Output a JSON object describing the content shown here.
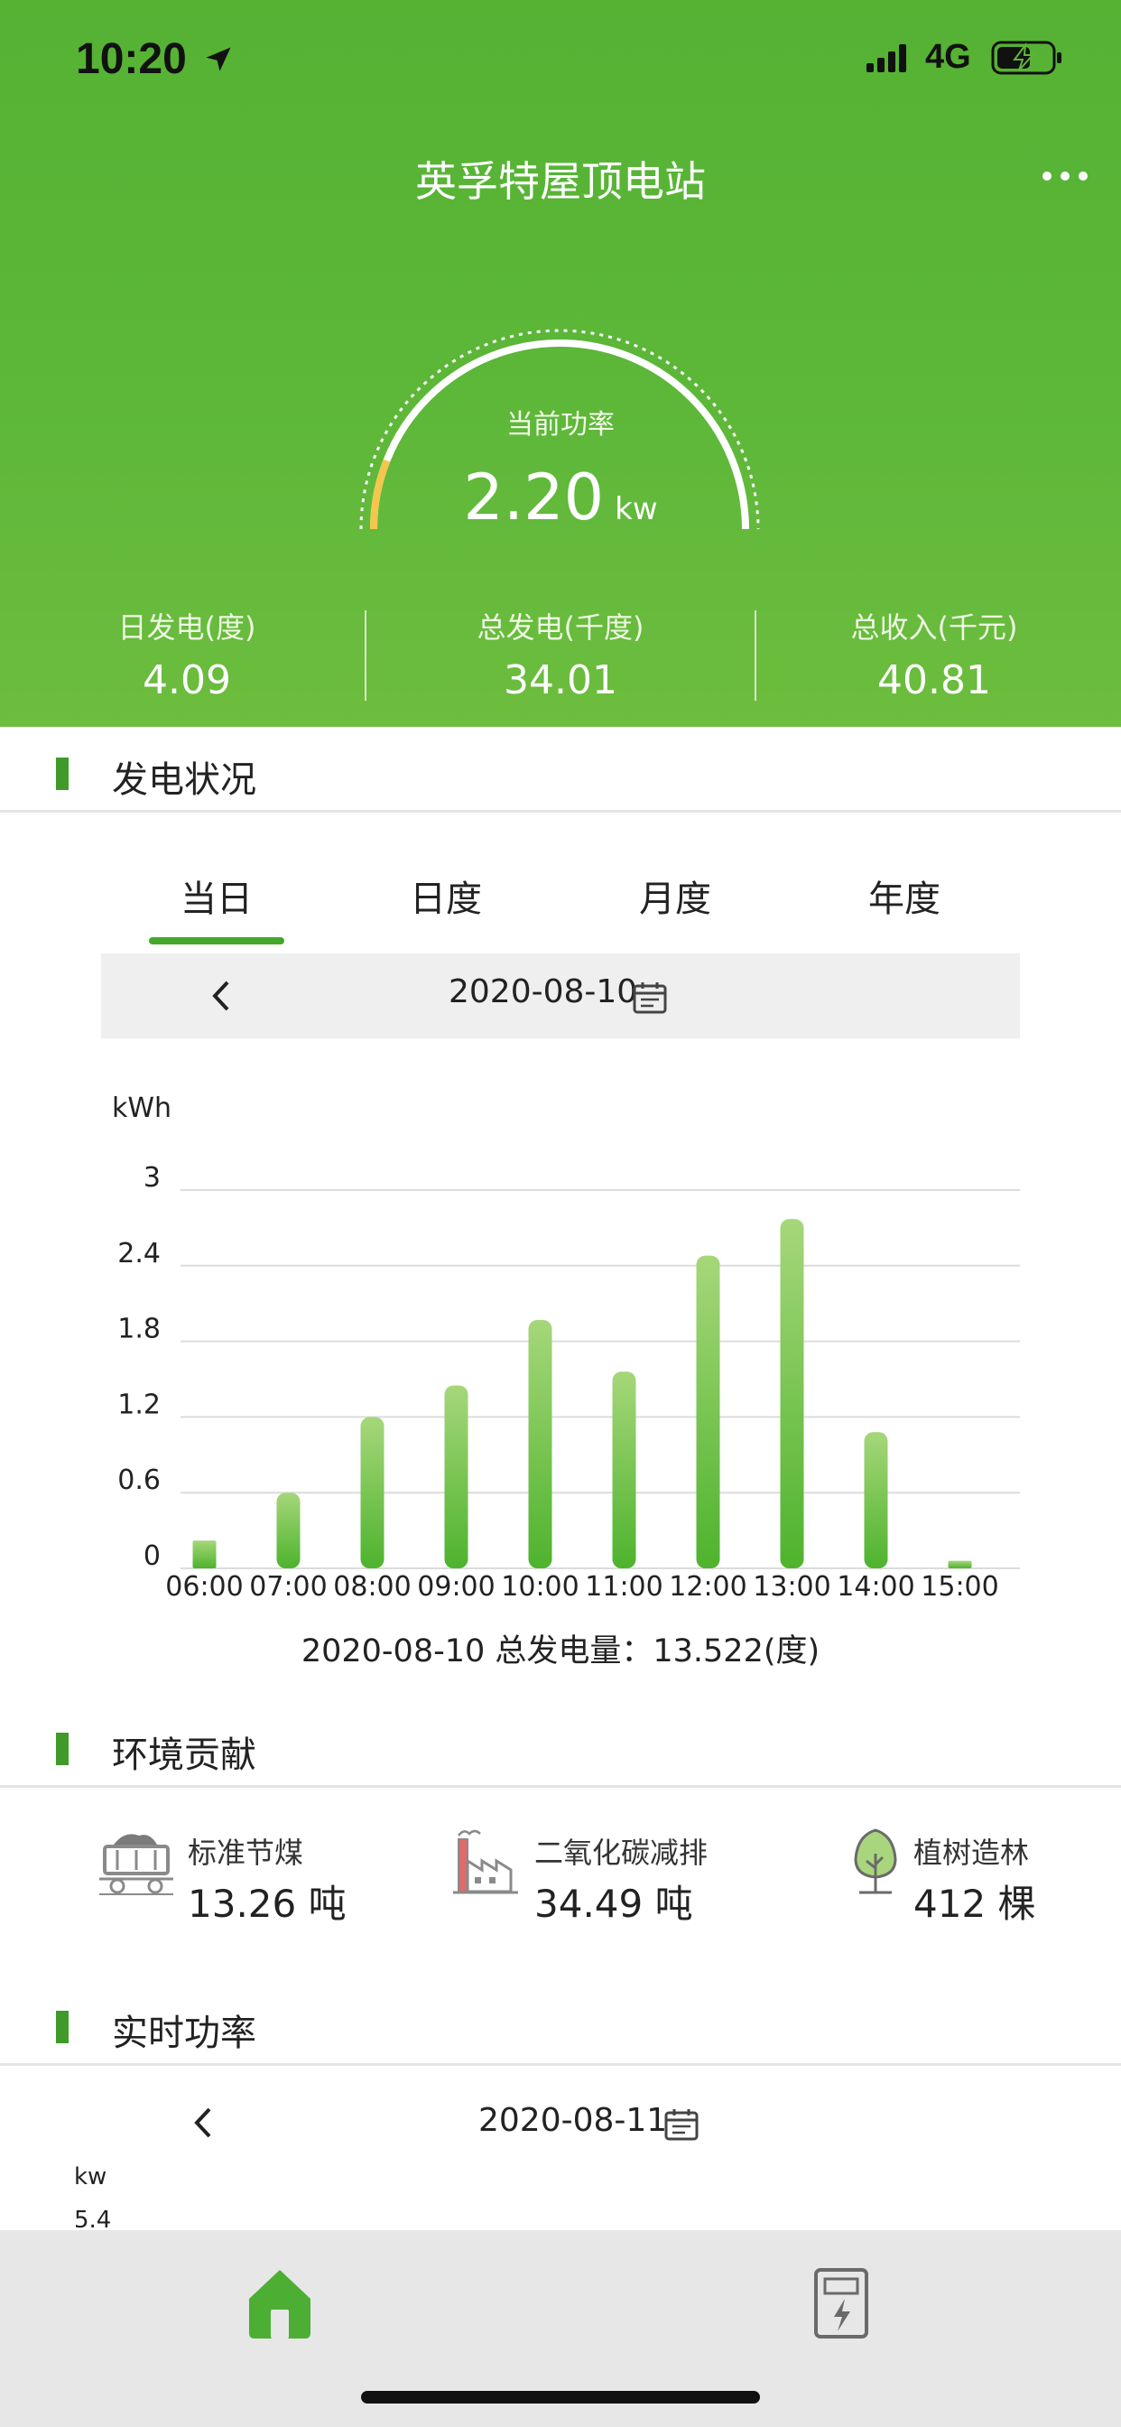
{
  "status_bar": {
    "time": "10:20",
    "network": "4G"
  },
  "header": {
    "title": "英孚特屋顶电站",
    "gauge": {
      "label": "当前功率",
      "value": "2.20",
      "unit": "kw",
      "fraction": 0.12
    },
    "stats": [
      {
        "label": "日发电(度)",
        "value": "4.09"
      },
      {
        "label": "总发电(千度)",
        "value": "34.01"
      },
      {
        "label": "总收入(千元)",
        "value": "40.81"
      }
    ]
  },
  "generation": {
    "section_title": "发电状况",
    "tabs": [
      "当日",
      "日度",
      "月度",
      "年度"
    ],
    "active_tab": "当日",
    "date": "2020-08-10",
    "total_text": "2020-08-10 总发电量：13.522(度)"
  },
  "chart_data": {
    "type": "bar",
    "ylabel": "kWh",
    "ylim": [
      0,
      3
    ],
    "yticks": [
      "0",
      "0.6",
      "1.2",
      "1.8",
      "2.4",
      "3"
    ],
    "categories": [
      "06:00",
      "07:00",
      "08:00",
      "09:00",
      "10:00",
      "11:00",
      "12:00",
      "13:00",
      "14:00",
      "15:00"
    ],
    "values": [
      0.22,
      0.6,
      1.2,
      1.45,
      1.97,
      1.56,
      2.48,
      2.77,
      1.08,
      0.06
    ],
    "grid": true,
    "bar_color": "#5cb83a"
  },
  "environment": {
    "section_title": "环境贡献",
    "items": [
      {
        "icon": "coal-cart-icon",
        "label": "标准节煤",
        "value": "13.26 吨"
      },
      {
        "icon": "factory-icon",
        "label": "二氧化碳减排",
        "value": "34.49 吨"
      },
      {
        "icon": "tree-icon",
        "label": "植树造林",
        "value": "412 棵"
      }
    ]
  },
  "realtime": {
    "section_title": "实时功率",
    "date": "2020-08-11",
    "unit": "kw",
    "first_tick": "5.4"
  },
  "colors": {
    "header_green": "#5db739",
    "accent_green": "#43a82a",
    "gauge_yellow": "#f4c64e"
  }
}
